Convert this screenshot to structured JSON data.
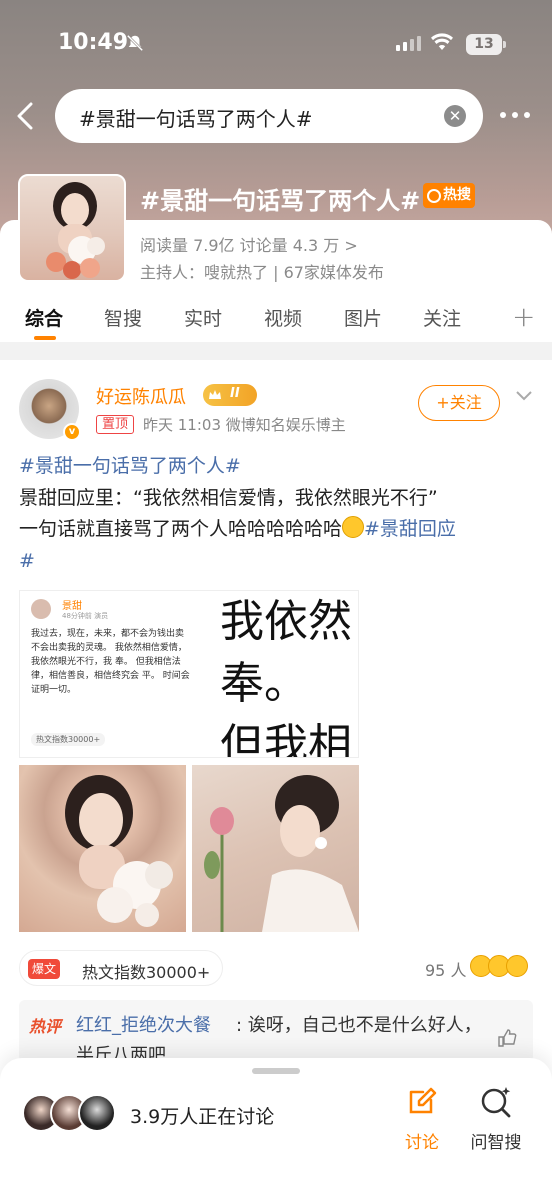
{
  "status": {
    "time": "10:49",
    "battery": "13"
  },
  "search": {
    "query": "#景甜一句话骂了两个人#"
  },
  "topic": {
    "title": "#景甜一句话骂了两个人#",
    "badge": "热搜",
    "stats": "阅读量 7.9亿  讨论量 4.3 万  >",
    "host": "主持人：嗖就热了 | 67家媒体发布"
  },
  "tabs": [
    "综合",
    "智搜",
    "实时",
    "视频",
    "图片",
    "关注"
  ],
  "post": {
    "user": "好运陈瓜瓜",
    "level": "II",
    "pinned": "置顶",
    "meta": "昨天 11:03   微博知名娱乐博主",
    "follow": "+关注",
    "hashtag": "#景甜一句话骂了两个人#",
    "line1": "景甜回应里：“我依然相信爱情，我依然眼光不行”",
    "line2": "一句话就直接骂了两个人哈哈哈哈哈哈",
    "hashtag2": "#景甜回应",
    "hashtag2_end": "#",
    "shot": {
      "name": "景甜",
      "meta": "48分钟前  演员",
      "text": "我过去，现在，未来，都不会为钱出卖 不会出卖我的灵魂。 我依然相信爱情，我依然眼光不行，我 奉。 但我相信法律，相信善良，相信终究会 平。 时间会证明一切。",
      "tag": "热文指数30000+",
      "zoom_text": "我依然 奉。 但我相"
    },
    "hot_label": "爆文",
    "hot_index": "热文指数30000+",
    "people": "95 人",
    "comment": {
      "hot": "热评",
      "user": "红红_拒绝次大餐",
      "text": ": 诶呀，自己也不是什么好人，半斤八两吧"
    }
  },
  "bottom": {
    "discussing": "3.9万人正在讨论",
    "discuss_btn": "讨论",
    "ask_btn": "问智搜"
  },
  "colors": {
    "accent": "#ff8200",
    "link": "#4a6ea9"
  }
}
